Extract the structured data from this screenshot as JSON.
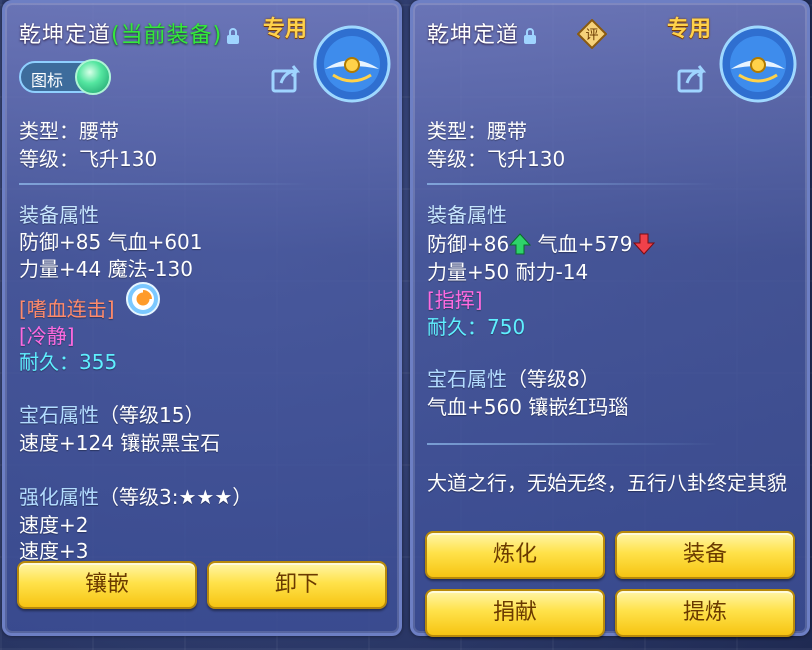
{
  "left_panel": {
    "title_name": "乾坤定道",
    "title_status": "(当前装备)",
    "special_tag": "专用",
    "badge_label": "图标",
    "type_label": "类型：",
    "type_value": "腰带",
    "level_label": "等级：",
    "level_value": "飞升130",
    "equip_attr_heading": "装备属性",
    "attr_line1": "防御+85 气血+601",
    "attr_line2": "力量+44 魔法-130",
    "skill_name": "[嗜血连击]",
    "effect_name": "[冷静]",
    "durability_label": "耐久：",
    "durability_value": "355",
    "gem_heading": "宝石属性",
    "gem_level": "（等级15）",
    "gem_line": "速度+124 镶嵌黑宝石",
    "enhance_heading": "强化属性",
    "enhance_level": "（等级3:★★★）",
    "enhance_line1": "速度+2",
    "enhance_line2": "速度+3",
    "btn_inlay": "镶嵌",
    "btn_unequip": "卸下"
  },
  "right_panel": {
    "title_name": "乾坤定道",
    "special_tag": "专用",
    "appraise_glyph": "评",
    "type_label": "类型：",
    "type_value": "腰带",
    "level_label": "等级：",
    "level_value": "飞升130",
    "equip_attr_heading": "装备属性",
    "attr_def": "防御+86",
    "attr_hp": "气血+579",
    "attr_line2": "力量+50 耐力-14",
    "effect_name": "[指挥]",
    "durability_label": "耐久：",
    "durability_value": "750",
    "gem_heading": "宝石属性",
    "gem_level": "（等级8）",
    "gem_line": "气血+560 镶嵌红玛瑙",
    "description": "大道之行，无始无终，五行八卦终定其貌",
    "btn_refine": "炼化",
    "btn_equip": "装备",
    "btn_donate": "捐献",
    "btn_extract": "提炼"
  },
  "colors": {
    "panel_border": "#6d7fc4",
    "equipped_green": "#34e83b",
    "special_gold": "#ffd24a",
    "heading_blue": "#c7e6ff",
    "skill_orange": "#ff8a6a",
    "effect_pink": "#ff6ae0",
    "durability_cyan": "#5ff0ff",
    "button_yellow": "#ffe24a",
    "arrow_up_green": "#2ed36a",
    "arrow_down_red": "#f0414a"
  }
}
